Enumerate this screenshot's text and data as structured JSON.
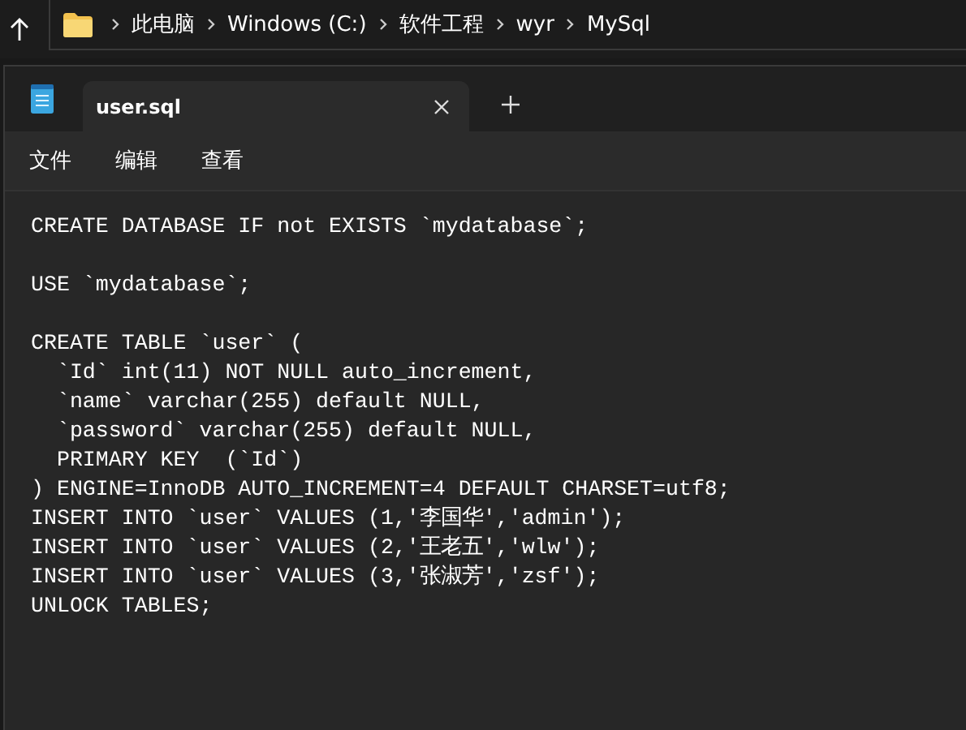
{
  "address_bar": {
    "breadcrumbs": [
      "此电脑",
      "Windows (C:)",
      "软件工程",
      "wyr",
      "MySql"
    ]
  },
  "tabs": [
    {
      "label": "user.sql",
      "selected": true
    }
  ],
  "menu": [
    "文件",
    "编辑",
    "查看"
  ],
  "editor": {
    "blocks": [
      {
        "lines": [
          "CREATE DATABASE IF not EXISTS `mydatabase`;"
        ]
      },
      {
        "lines": [
          "USE `mydatabase`;"
        ]
      },
      {
        "lines": [
          "CREATE TABLE `user` (",
          "  `Id` int(11) NOT NULL auto_increment,",
          "  `name` varchar(255) default NULL,",
          "  `password` varchar(255) default NULL,",
          "  PRIMARY KEY  (`Id`)",
          ") ENGINE=InnoDB AUTO_INCREMENT=4 DEFAULT CHARSET=utf8;",
          "INSERT INTO `user` VALUES (1,'李国华','admin');",
          "INSERT INTO `user` VALUES (2,'王老五','wlw');",
          "INSERT INTO `user` VALUES (3,'张淑芳','zsf');",
          "UNLOCK TABLES;"
        ]
      }
    ]
  }
}
